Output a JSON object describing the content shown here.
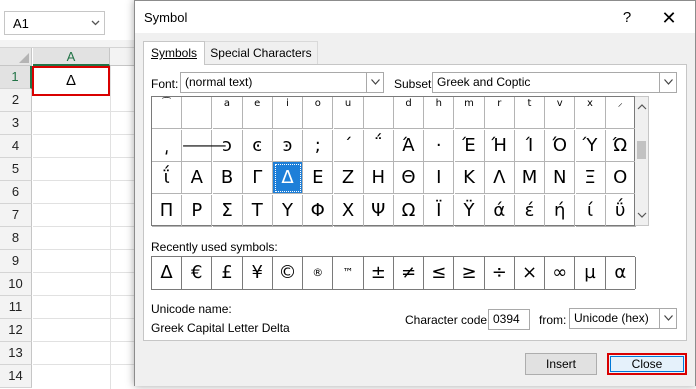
{
  "excel": {
    "name_box": "A1",
    "column_header": "A",
    "row_numbers": [
      "1",
      "2",
      "3",
      "4",
      "5",
      "6",
      "7",
      "8",
      "9",
      "10",
      "11",
      "12",
      "13",
      "14"
    ],
    "cell_a1": "Δ"
  },
  "dialog": {
    "title": "Symbol",
    "help_label": "?",
    "close_glyph": "✕",
    "tabs": [
      {
        "label": "Symbols"
      },
      {
        "label": "Special Characters"
      }
    ],
    "font_label": "Font:",
    "font_value": "(normal text)",
    "subset_label": "Subset:",
    "subset_value": "Greek and Coptic",
    "symbols": [
      "⁀",
      "",
      "a",
      "e",
      "i",
      "o",
      "u",
      "",
      "d",
      "h",
      "m",
      "r",
      "t",
      "v",
      "x",
      "⸝",
      "͵",
      "⸻",
      "ͻ",
      "ͼ",
      "ͽ",
      ";",
      "΄",
      "΅",
      "Ά",
      "·",
      "Έ",
      "Ή",
      "Ί",
      "Ό",
      "Ύ",
      "Ώ",
      "ΐ",
      "Α",
      "Β",
      "Γ",
      "Δ",
      "Ε",
      "Ζ",
      "Η",
      "Θ",
      "Ι",
      "Κ",
      "Λ",
      "Μ",
      "Ν",
      "Ξ",
      "Ο",
      "Π",
      "Ρ",
      "Σ",
      "Τ",
      "Υ",
      "Φ",
      "Χ",
      "Ψ",
      "Ω",
      "Ϊ",
      "Ϋ",
      "ά",
      "έ",
      "ή",
      "ί",
      "ΰ"
    ],
    "selected_symbol_index": 36,
    "recently_used_label": "Recently used symbols:",
    "recent_symbols": [
      "Δ",
      "€",
      "£",
      "¥",
      "©",
      "®",
      "™",
      "±",
      "≠",
      "≤",
      "≥",
      "÷",
      "×",
      "∞",
      "µ",
      "α"
    ],
    "unicode_name_label": "Unicode name:",
    "unicode_name_value": "Greek Capital Letter Delta",
    "character_code_label": "Character code:",
    "character_code_value": "0394",
    "from_label": "from:",
    "from_value": "Unicode (hex)",
    "insert_button": "Insert",
    "close_button": "Close"
  },
  "colors": {
    "selection": "#1e7fd8",
    "highlight_red": "#d90000",
    "excel_green": "#217346"
  }
}
